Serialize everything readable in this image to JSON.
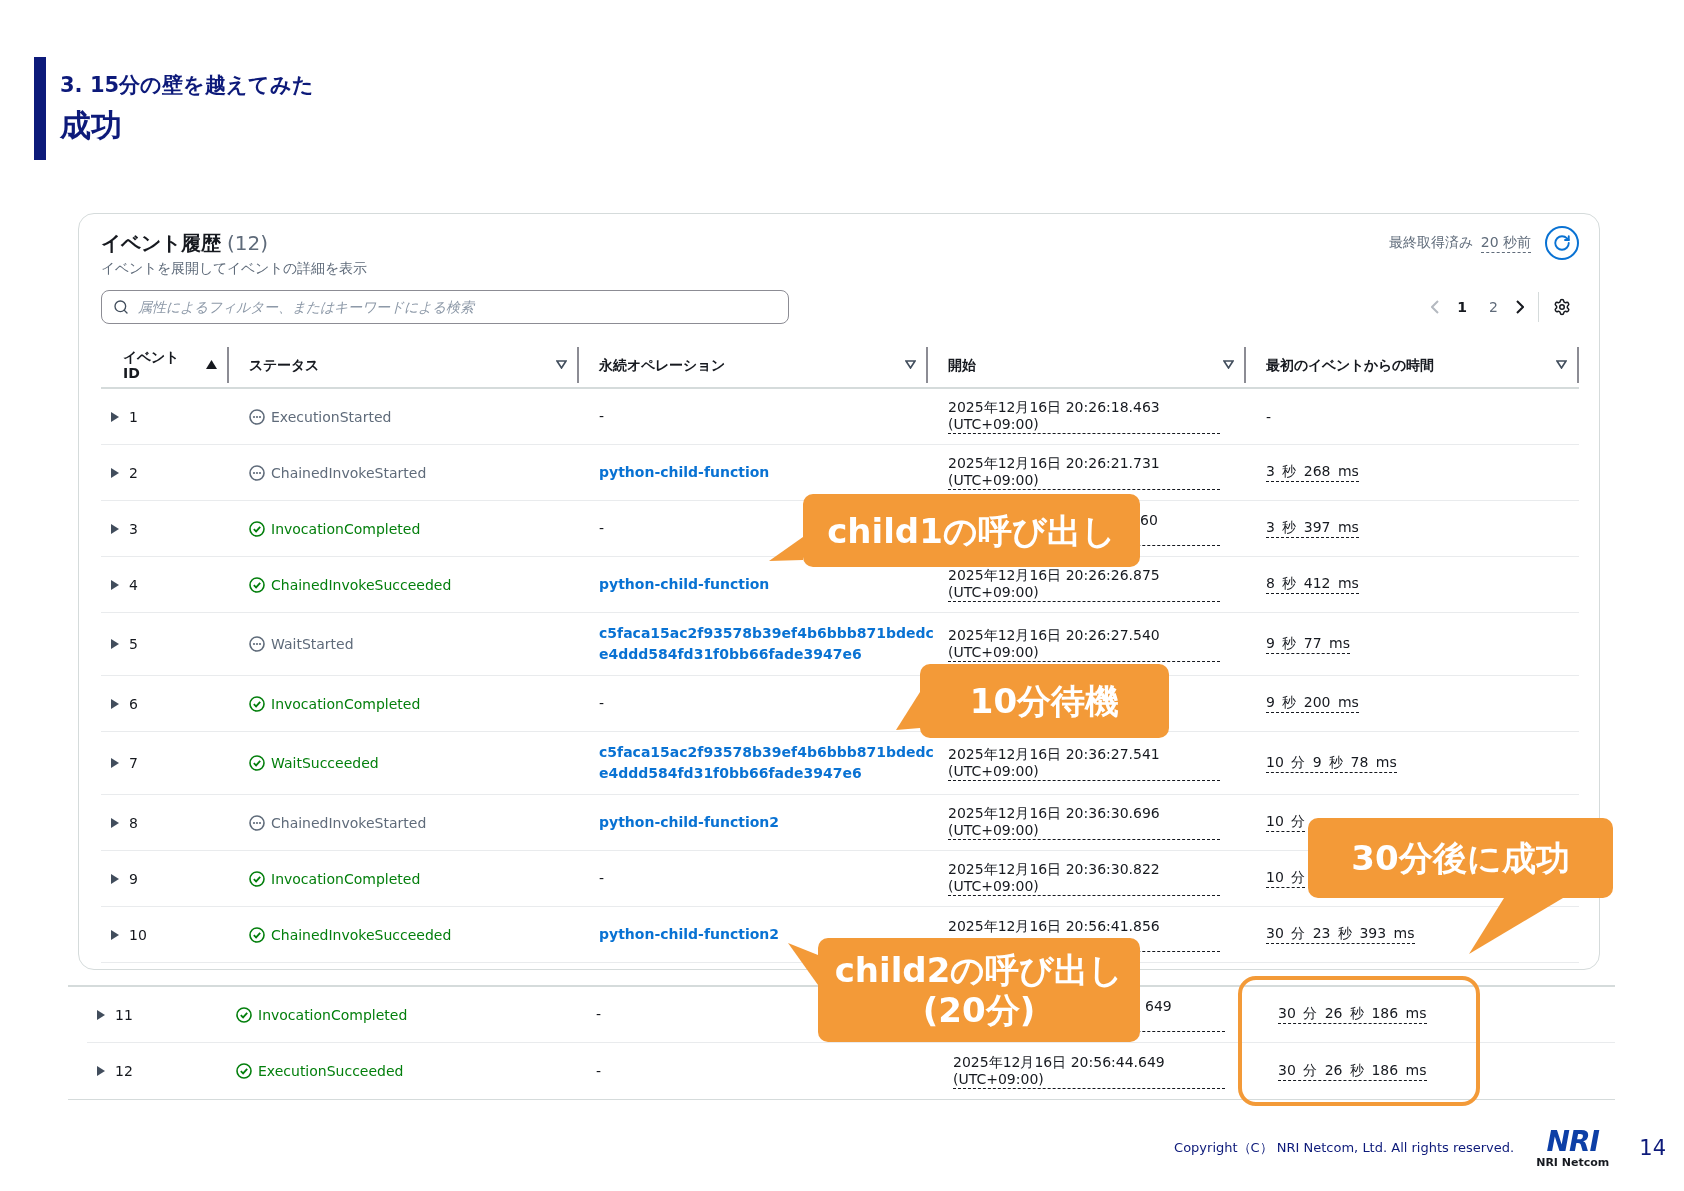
{
  "slide": {
    "section": "3. 15分の壁を越えてみた",
    "title": "成功"
  },
  "panel": {
    "title": "イベント履歴",
    "count": "(12)",
    "subtitle": "イベントを展開してイベントの詳細を表示",
    "refresh_label": "最終取得済み",
    "refresh_time": "20 秒前",
    "search": {
      "placeholder": "属性によるフィルター、またはキーワードによる検索"
    },
    "pagination": {
      "previous_disabled": true,
      "next_disabled": false,
      "pages": [
        {
          "label": "1",
          "selected": true
        },
        {
          "label": "2",
          "selected": false
        }
      ]
    },
    "columns": [
      {
        "label": "イベント ID",
        "sorted": true
      },
      {
        "label": "ステータス",
        "sorted": false
      },
      {
        "label": "永続オペレーション",
        "sorted": false
      },
      {
        "label": "開始",
        "sorted": false
      },
      {
        "label": "最初のイベントからの時間",
        "sorted": false
      }
    ],
    "rows": [
      {
        "id": "1",
        "expanded": false,
        "status": {
          "label": "ExecutionStarted",
          "kind": "pending"
        },
        "operation": {
          "lines": [
            "-"
          ],
          "kind": "plain"
        },
        "start": {
          "lines": [
            "2025年12月16日 20:26:18.463",
            "(UTC+09:00)"
          ],
          "kind": "full"
        },
        "elapsed": {
          "text": "-",
          "kind": "plain"
        }
      },
      {
        "id": "2",
        "expanded": false,
        "status": {
          "label": "ChainedInvokeStarted",
          "kind": "pending"
        },
        "operation": {
          "lines": [
            "python-child-function"
          ],
          "kind": "link"
        },
        "start": {
          "lines": [
            "2025年12月16日 20:26:21.731",
            "(UTC+09:00)"
          ],
          "kind": "full"
        },
        "elapsed": {
          "text": "3 秒 268 ms",
          "kind": "duration"
        }
      },
      {
        "id": "3",
        "expanded": false,
        "status": {
          "label": "InvocationCompleted",
          "kind": "success"
        },
        "operation": {
          "lines": [
            "-"
          ],
          "kind": "plain"
        },
        "start": {
          "lines": [
            "60"
          ],
          "kind": "tail"
        },
        "elapsed": {
          "text": "3 秒 397 ms",
          "kind": "duration"
        }
      },
      {
        "id": "4",
        "expanded": false,
        "status": {
          "label": "ChainedInvokeSucceeded",
          "kind": "success"
        },
        "operation": {
          "lines": [
            "python-child-function"
          ],
          "kind": "link"
        },
        "start": {
          "lines": [
            "2025年12月16日 20:26:26.875",
            "(UTC+09:00)"
          ],
          "kind": "full"
        },
        "elapsed": {
          "text": "8 秒 412 ms",
          "kind": "duration"
        }
      },
      {
        "id": "5",
        "expanded": false,
        "status": {
          "label": "WaitStarted",
          "kind": "pending"
        },
        "operation": {
          "lines": [
            "c5faca15ac2f93578b39ef4b6bbb871bdedc",
            "e4ddd584fd31f0bb66fade3947e6"
          ],
          "kind": "link"
        },
        "start": {
          "lines": [
            "2025年12月16日 20:26:27.540",
            "(UTC+09:00)"
          ],
          "kind": "full"
        },
        "elapsed": {
          "text": "9 秒 77 ms",
          "kind": "duration"
        }
      },
      {
        "id": "6",
        "expanded": false,
        "status": {
          "label": "InvocationCompleted",
          "kind": "success"
        },
        "operation": {
          "lines": [
            "-"
          ],
          "kind": "plain"
        },
        "elapsed": {
          "text": "9 秒 200 ms",
          "kind": "duration"
        }
      },
      {
        "id": "7",
        "expanded": false,
        "status": {
          "label": "WaitSucceeded",
          "kind": "success"
        },
        "operation": {
          "lines": [
            "c5faca15ac2f93578b39ef4b6bbb871bdedc",
            "e4ddd584fd31f0bb66fade3947e6"
          ],
          "kind": "link"
        },
        "start": {
          "lines": [
            "2025年12月16日 20:36:27.541",
            "(UTC+09:00)"
          ],
          "kind": "full"
        },
        "elapsed": {
          "text": "10 分 9 秒 78 ms",
          "kind": "duration"
        }
      },
      {
        "id": "8",
        "expanded": false,
        "status": {
          "label": "ChainedInvokeStarted",
          "kind": "pending"
        },
        "operation": {
          "lines": [
            "python-child-function2"
          ],
          "kind": "link"
        },
        "start": {
          "lines": [
            "2025年12月16日 20:36:30.696",
            "(UTC+09:00)"
          ],
          "kind": "full"
        },
        "elapsed": {
          "text": "10 分",
          "kind": "duration"
        }
      },
      {
        "id": "9",
        "expanded": false,
        "status": {
          "label": "InvocationCompleted",
          "kind": "success"
        },
        "operation": {
          "lines": [
            "-"
          ],
          "kind": "plain"
        },
        "start": {
          "lines": [
            "2025年12月16日 20:36:30.822",
            "(UTC+09:00)"
          ],
          "kind": "full"
        },
        "elapsed": {
          "text": "10 分",
          "kind": "duration"
        }
      },
      {
        "id": "10",
        "expanded": false,
        "status": {
          "label": "ChainedInvokeSucceeded",
          "kind": "success"
        },
        "operation": {
          "lines": [
            "python-child-function2"
          ],
          "kind": "link"
        },
        "start": {
          "lines": [
            "2025年12月16日 20:56:41.856"
          ],
          "kind": "full"
        },
        "elapsed": {
          "text": "30 分 23 秒 393 ms",
          "kind": "duration"
        }
      }
    ]
  },
  "continuation_rows": [
    {
      "id": "11",
      "expanded": false,
      "status": {
        "label": "InvocationCompleted",
        "kind": "success"
      },
      "operation": {
        "lines": [
          "-"
        ],
        "kind": "plain"
      },
      "start": {
        "lines": [
          "649"
        ],
        "kind": "tail"
      },
      "elapsed": {
        "text": "30 分 26 秒 186 ms",
        "kind": "duration"
      }
    },
    {
      "id": "12",
      "expanded": false,
      "status": {
        "label": "ExecutionSucceeded",
        "kind": "success"
      },
      "operation": {
        "lines": [
          "-"
        ],
        "kind": "plain"
      },
      "start": {
        "lines": [
          "2025年12月16日 20:56:44.649",
          "(UTC+09:00)"
        ],
        "kind": "full"
      },
      "elapsed": {
        "text": "30 分 26 秒 186 ms",
        "kind": "duration"
      }
    }
  ],
  "callouts": [
    {
      "lines": [
        "child1の呼び出し"
      ]
    },
    {
      "lines": [
        "10分待機"
      ]
    },
    {
      "lines": [
        "30分後に成功"
      ]
    },
    {
      "lines": [
        "child2の呼び出し",
        "(20分)"
      ]
    }
  ],
  "footer": {
    "copyright": "Copyright（C） NRI Netcom, Ltd. All rights reserved.",
    "logo_mark": "NRI",
    "logo_name": "NRI Netcom",
    "page": "14"
  }
}
